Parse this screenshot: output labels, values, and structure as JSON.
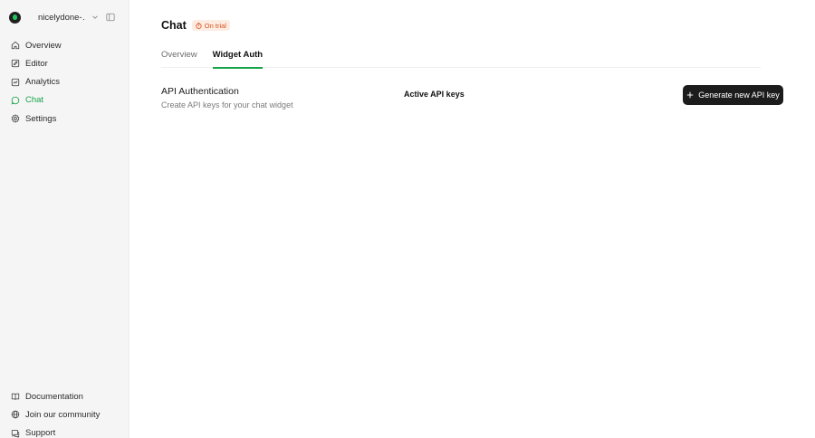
{
  "sidebar": {
    "workspace": {
      "name": "nicelydone-…",
      "logo_icon": "workspace-logo-icon"
    },
    "items": [
      {
        "label": "Overview",
        "icon": "home-icon"
      },
      {
        "label": "Editor",
        "icon": "edit-icon"
      },
      {
        "label": "Analytics",
        "icon": "analytics-icon"
      },
      {
        "label": "Chat",
        "icon": "chat-icon",
        "active": true
      },
      {
        "label": "Settings",
        "icon": "gear-icon"
      }
    ],
    "bottom_items": [
      {
        "label": "Documentation",
        "icon": "book-icon"
      },
      {
        "label": "Join our community",
        "icon": "globe-icon"
      },
      {
        "label": "Support",
        "icon": "support-icon"
      }
    ]
  },
  "header": {
    "title": "Chat",
    "badge": "On trial"
  },
  "tabs": [
    {
      "label": "Overview",
      "active": false
    },
    {
      "label": "Widget Auth",
      "active": true
    }
  ],
  "api_auth": {
    "title": "API Authentication",
    "description": "Create API keys for your chat widget",
    "active_keys_label": "Active API keys",
    "generate_button": "Generate new API key"
  },
  "colors": {
    "accent": "#16a34a",
    "trial_badge_bg": "#fdece2",
    "trial_badge_text": "#d9531e",
    "button_bg": "#1c1c1c",
    "sidebar_bg": "#f5f5f5"
  }
}
